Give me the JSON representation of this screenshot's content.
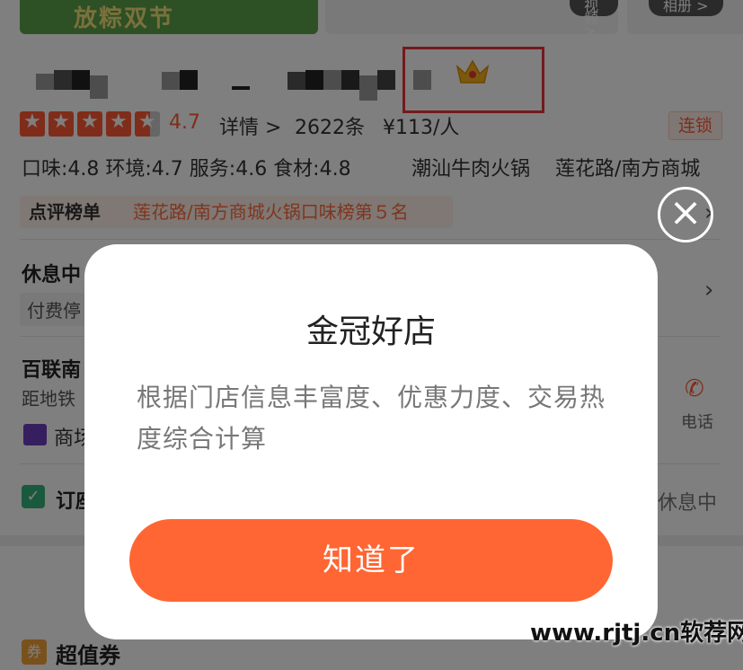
{
  "banner": {
    "left_text": "放粽双节",
    "buttons": [
      "视频 >",
      "相册 >"
    ]
  },
  "shop": {
    "rating": "4.7",
    "detail_label": "详情 >",
    "reviews": "2622条",
    "price": "¥113/人",
    "chain_tag": "连锁",
    "scores": "口味:4.8  环境:4.7  服务:4.6  食材:4.8",
    "category": "潮汕牛肉火锅",
    "location": "莲花路/南方商城",
    "rank_badge": "点评榜单",
    "rank_text": "莲花路/南方商城火锅口味榜第５名"
  },
  "info": {
    "status": "休息中",
    "paid_parking": "付费停",
    "address_title": "百联南",
    "distance": "距地铁",
    "mall": "商场",
    "phone_label": "电话",
    "booking": "订座",
    "booking_status": "休息中",
    "coupon_icon": "券",
    "coupon_title": "超值券"
  },
  "dialog": {
    "title": "金冠好店",
    "body": "根据门店信息丰富度、优惠力度、交易热度综合计算",
    "confirm": "知道了",
    "close_icon": "close-icon"
  },
  "watermark": "www.rjtj.cn软荐网",
  "colors": {
    "accent": "#ff6633",
    "highlight_box": "#e8353b",
    "overlay": "rgba(0,0,0,0.5)"
  }
}
